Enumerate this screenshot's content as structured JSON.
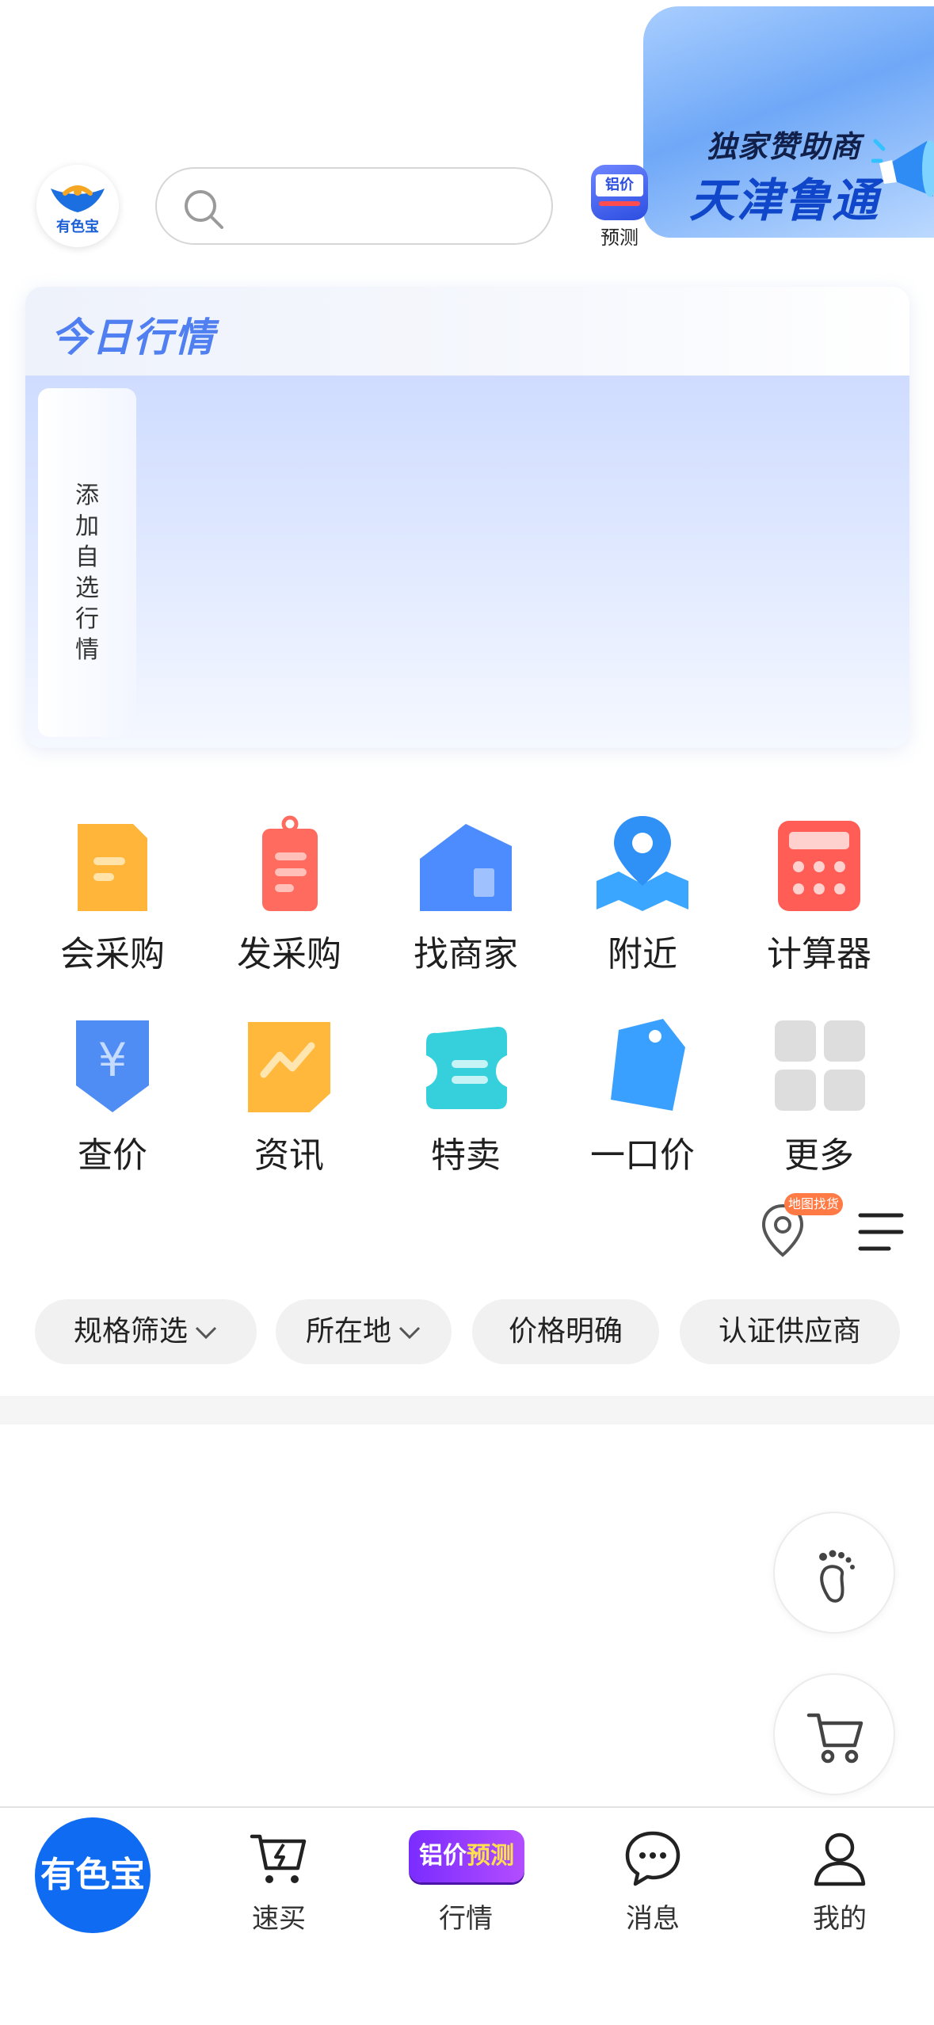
{
  "header": {
    "sponsor": {
      "label": "独家赞助商",
      "name": "天津鲁通"
    },
    "logo_text": "有色宝",
    "search_placeholder": "",
    "forecast": {
      "icon_text": "铝价",
      "label": "预测"
    }
  },
  "market": {
    "title": "今日行情",
    "add_favorite": "添加自选行情"
  },
  "grid": [
    {
      "label": "会采购",
      "icon": "clipboard-icon",
      "color": "#ffb53a"
    },
    {
      "label": "发采购",
      "icon": "order-tag-icon",
      "color": "#ff6b5e"
    },
    {
      "label": "找商家",
      "icon": "store-icon",
      "color": "#4d8cff"
    },
    {
      "label": "附近",
      "icon": "map-pin-icon",
      "color": "#3aa6ff"
    },
    {
      "label": "计算器",
      "icon": "calculator-icon",
      "color": "#ff5d55"
    },
    {
      "label": "查价",
      "icon": "yuan-shield-icon",
      "color": "#4f8df5"
    },
    {
      "label": "资讯",
      "icon": "news-chart-icon",
      "color": "#ffb83b"
    },
    {
      "label": "特卖",
      "icon": "ticket-icon",
      "color": "#35d0dc"
    },
    {
      "label": "一口价",
      "icon": "price-tag-icon",
      "color": "#3aa0ff"
    },
    {
      "label": "更多",
      "icon": "more-grid-icon",
      "color": "#dddddd"
    }
  ],
  "filters": {
    "map_badge": "地图找货",
    "chips": [
      "规格筛选",
      "所在地",
      "价格明确",
      "认证供应商"
    ]
  },
  "tabbar": {
    "home": "有色宝",
    "items": [
      {
        "label": "速买",
        "icon": "quick-buy-cart-icon"
      },
      {
        "label": "行情",
        "icon": "price-forecast-badge",
        "badge": "铝价",
        "badge_highlight": "预测"
      },
      {
        "label": "消息",
        "icon": "chat-bubble-icon"
      },
      {
        "label": "我的",
        "icon": "user-icon"
      }
    ]
  }
}
